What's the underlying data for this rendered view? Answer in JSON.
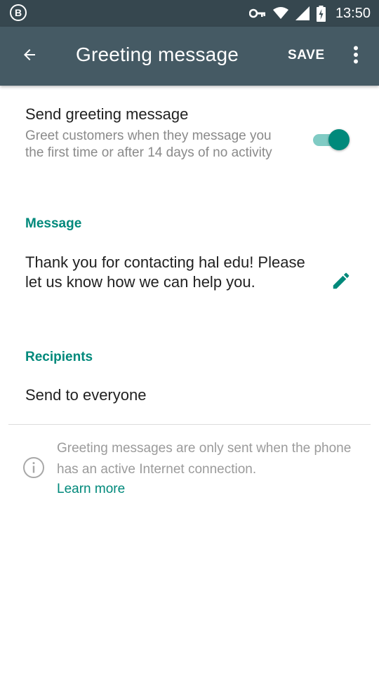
{
  "status_bar": {
    "b_label": "B",
    "time": "13:50",
    "icons": [
      "key-icon",
      "wifi-icon",
      "cellular-signal-icon",
      "battery-charging-icon"
    ]
  },
  "app_bar": {
    "title": "Greeting message",
    "save_label": "SAVE",
    "icons": [
      "back-arrow-icon",
      "more-vert-icon"
    ]
  },
  "greeting_toggle": {
    "title": "Send greeting message",
    "description": "Greet customers when they message you the first time or after 14 days of no activity",
    "enabled": true
  },
  "message_section": {
    "header": "Message",
    "text": "Thank you for contacting hal edu! Please let us know how we can help you."
  },
  "recipients_section": {
    "header": "Recipients",
    "value": "Send to everyone"
  },
  "info_note": {
    "text": "Greeting messages are only sent when the phone has an active Internet connection.",
    "link_label": "Learn more"
  },
  "colors": {
    "app_bar": "#455a64",
    "status_bar": "#36474f",
    "accent": "#00897b",
    "switch_track": "#80cbc4"
  }
}
